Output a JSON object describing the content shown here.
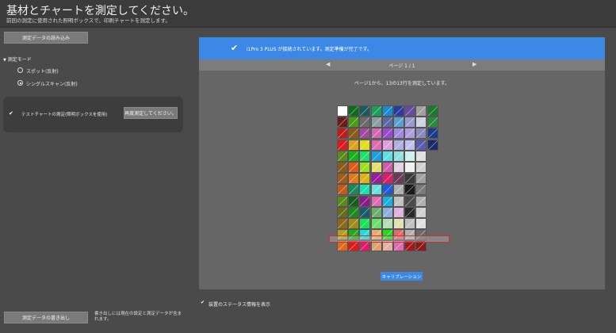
{
  "header": {
    "title": "基材とチャートを測定してください。",
    "subtitle": "前回の測定に使用された照明ボックスで、印刷チャートを測定します。"
  },
  "left": {
    "load_button": "測定データの読み込み",
    "mode_label": "測定モード",
    "mode_options": [
      {
        "label": "スポット(反射)",
        "selected": false
      },
      {
        "label": "シングルスキャン(反射)",
        "selected": true
      }
    ],
    "test_chart_label": "テストチャートの測定(照明ボックスを使用)",
    "remeasure_button": "再度測定してください。",
    "export_button": "測定データの書き出し",
    "export_note": "書き出しには現在の設定と測定データが含まれます。"
  },
  "right": {
    "banner_text": "i1Pro 3 PLUS が接続されています。測定準備が完了です。",
    "page_label": "ページ 1 / 1",
    "measure_text": "ページ1から、13の13行を測定しています。",
    "calibration_button": "キャリブレーション",
    "status_label": "装置のステータス情報を表示"
  },
  "chart_data": {
    "type": "table",
    "columns": 10,
    "highlighted_row": 11,
    "rows": [
      [
        "#ffffff",
        "#0d6b1e",
        "#1a5a5a",
        "#1aa05a",
        "#1a8bd0",
        "#2a3aa0",
        "#6a4aa0",
        "#a0a0a0",
        "#1a7a2a"
      ],
      [
        "#6b1a1a",
        "#4a9a1a",
        "#6b6b6b",
        "#8aa0a0",
        "#5a6aa0",
        "#5aa0d0",
        "#9a9ad0",
        "#d0d0e0",
        "#2a8a3a"
      ],
      [
        "#c01a1a",
        "#8a5a1a",
        "#a04aa0",
        "#d06ab0",
        "#9a4ad0",
        "#a08ae0",
        "#b09ae0",
        "#8a8ac0",
        "#1a3a8a"
      ],
      [
        "#e01a1a",
        "#e0a01a",
        "#e0e01a",
        "#e06ab0",
        "#e0a0e0",
        "#b0b0e0",
        "#c0c0f0",
        "#5a5ab0",
        "#1a2a6a"
      ],
      [
        "#5a8a1a",
        "#1ab01a",
        "#1ae06a",
        "#1aa0e0",
        "#5ae0e0",
        "#90e0e0",
        "#d0f0f0",
        "#e0e0e0"
      ],
      [
        "#8a5a1a",
        "#e05a1a",
        "#9ae01a",
        "#e0e06a",
        "#d05ab0",
        "#e0d0e0",
        "#f0f0f0",
        "#d0d0d0"
      ],
      [
        "#a05a1a",
        "#e07a1a",
        "#e0b01a",
        "#9a1aa0",
        "#e01a6a",
        "#6a3a5a",
        "#3a3a3a",
        "#a0a0a0"
      ],
      [
        "#c05a1a",
        "#1a8a5a",
        "#1ae0b0",
        "#6ae0e0",
        "#1a5ae0",
        "#b0b0b0",
        "#1a1a1a",
        "#7a7a7a"
      ],
      [
        "#5a8a1a",
        "#1a5a1a",
        "#8a1a8a",
        "#e06ab0",
        "#1ab0e0",
        "#c0c0c0",
        "#4a4a4a",
        "#b0b0b0"
      ],
      [
        "#6a6a1a",
        "#1a8a1a",
        "#1a5a6a",
        "#6ab06a",
        "#8ab0e0",
        "#e0b0e0",
        "#2a2a2a",
        "#d0d0d0"
      ],
      [
        "#8a6a1a",
        "#a08a1a",
        "#1ae05a",
        "#6ae06a",
        "#b0e0b0",
        "#e0e0b0",
        "#c0c0c0",
        "#e0e0e0"
      ],
      [
        "#b0a01a",
        "#1ab01a",
        "#1ae0e0",
        "#e0b06a",
        "#1ae01a",
        "#e06a6a",
        "#b0b0b0",
        "#6a6a6a"
      ],
      [
        "#e06a1a",
        "#e01a1a",
        "#e01a6a",
        "#e0a06a",
        "#e0b0a0",
        "#e06ab0",
        "#a01a1a",
        "#8a1a1a"
      ]
    ]
  }
}
